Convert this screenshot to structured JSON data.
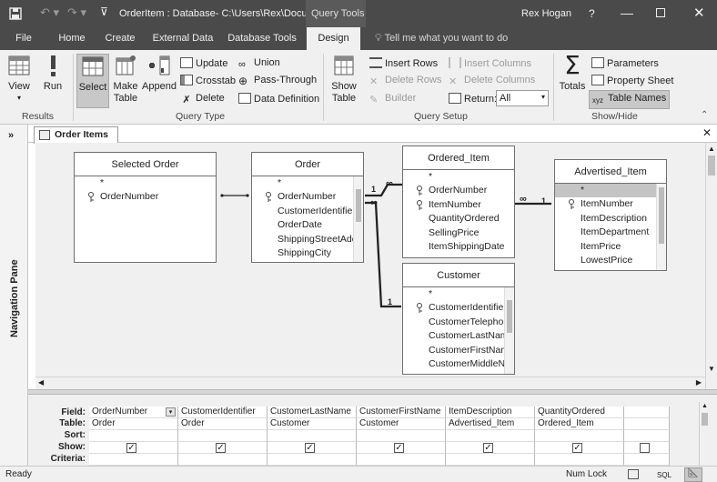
{
  "titlebar": {
    "title": "OrderItem : Database- C:\\Users\\Rex\\Docu...",
    "context": "Query Tools",
    "user": "Rex Hogan",
    "help": "?"
  },
  "tabs": [
    "File",
    "Home",
    "Create",
    "External Data",
    "Database Tools",
    "Design"
  ],
  "tell_me": "Tell me what you want to do",
  "ribbon": {
    "results": {
      "label": "Results",
      "view": "View",
      "run": "Run"
    },
    "query_type": {
      "label": "Query Type",
      "select": "Select",
      "make_table": "Make Table",
      "append": "Append",
      "update": "Update",
      "crosstab": "Crosstab",
      "delete": "Delete",
      "union": "Union",
      "pass_through": "Pass-Through",
      "data_definition": "Data Definition"
    },
    "query_setup": {
      "label": "Query Setup",
      "show_table": "Show Table",
      "insert_rows": "Insert Rows",
      "delete_rows": "Delete Rows",
      "builder": "Builder",
      "insert_columns": "Insert Columns",
      "delete_columns": "Delete Columns",
      "return_label": "Return:",
      "return_value": "All"
    },
    "show_hide": {
      "label": "Show/Hide",
      "totals": "Totals",
      "parameters": "Parameters",
      "property_sheet": "Property Sheet",
      "table_names": "Table Names"
    }
  },
  "nav_pane": "Navigation Pane",
  "doc_tab": "Order Items",
  "tables": {
    "selected_order": {
      "title": "Selected Order",
      "fields": [
        "*",
        "OrderNumber"
      ]
    },
    "order": {
      "title": "Order",
      "fields": [
        "*",
        "OrderNumber",
        "CustomerIdentifie",
        "OrderDate",
        "ShippingStreetAdc",
        "ShippingCity"
      ]
    },
    "ordered_item": {
      "title": "Ordered_Item",
      "fields": [
        "*",
        "OrderNumber",
        "ItemNumber",
        "QuantityOrdered",
        "SellingPrice",
        "ItemShippingDate"
      ]
    },
    "customer": {
      "title": "Customer",
      "fields": [
        "*",
        "CustomerIdentifie",
        "CustomerTelephor",
        "CustomerLastNam",
        "CustomerFirstNam",
        "CustomerMiddleN"
      ]
    },
    "advertised_item": {
      "title": "Advertised_Item",
      "fields": [
        "*",
        "ItemNumber",
        "ItemDescription",
        "ItemDepartment",
        "ItemPrice",
        "LowestPrice"
      ]
    }
  },
  "join_labels": {
    "one": "1",
    "many": "∞"
  },
  "grid": {
    "row_labels": [
      "Field:",
      "Table:",
      "Sort:",
      "Show:",
      "Criteria:"
    ],
    "columns": [
      {
        "field": "OrderNumber",
        "table": "Order",
        "show": true
      },
      {
        "field": "CustomerIdentifier",
        "table": "Order",
        "show": true
      },
      {
        "field": "CustomerLastName",
        "table": "Customer",
        "show": true
      },
      {
        "field": "CustomerFirstName",
        "table": "Customer",
        "show": true
      },
      {
        "field": "ItemDescription",
        "table": "Advertised_Item",
        "show": true
      },
      {
        "field": "QuantityOrdered",
        "table": "Ordered_Item",
        "show": true
      },
      {
        "field": "",
        "table": "",
        "show": false
      }
    ]
  },
  "status": {
    "ready": "Ready",
    "num_lock": "Num Lock",
    "sql": "SQL"
  },
  "colors": {
    "titlebar": "#4a4a4a",
    "ribbon": "#f0f0f0",
    "canvas": "#f0f0f0",
    "selected": "#c4c4c4"
  }
}
